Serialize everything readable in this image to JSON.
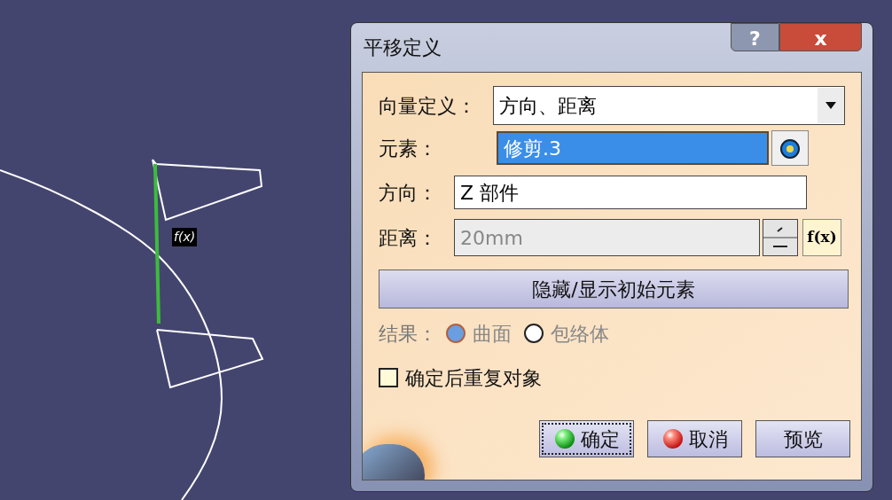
{
  "viewport": {
    "formula_label": "f(x)"
  },
  "window": {
    "title": "平移定义",
    "help_button": "?",
    "close_button": "x"
  },
  "vector_definition": {
    "label": "向量定义：",
    "value": "方向、距离"
  },
  "element": {
    "label": "元素：",
    "value": "修剪.3",
    "selected": true
  },
  "direction": {
    "label": "方向：",
    "value": "Z 部件"
  },
  "distance": {
    "label": "距离：",
    "value": "20mm",
    "disabled": true,
    "formula_button": "f(x)"
  },
  "toggle_button": "隐藏/显示初始元素",
  "result": {
    "label": "结果：",
    "disabled": true,
    "options": [
      {
        "label": "曲面",
        "selected": true
      },
      {
        "label": "包络体",
        "selected": false
      }
    ]
  },
  "repeat_checkbox": {
    "label": "确定后重复对象",
    "checked": false
  },
  "buttons": [
    {
      "label": "确定",
      "kind": "ok"
    },
    {
      "label": "取消",
      "kind": "cancel"
    },
    {
      "label": "预览",
      "kind": "preview"
    }
  ]
}
